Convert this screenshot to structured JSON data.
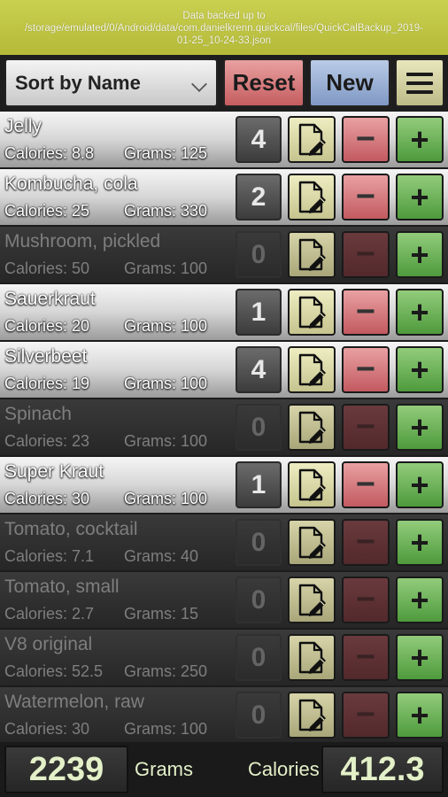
{
  "status_banner": {
    "line1": "Data backed up to",
    "line2": "/storage/emulated/0/Android/data/com.danielkrenn.quickcal/files/QuickCalBackup_2019-",
    "line3": "01-25_10-24-33.json"
  },
  "toolbar": {
    "sort_label": "Sort by Name",
    "reset_label": "Reset",
    "new_label": "New"
  },
  "labels": {
    "calories_prefix": "Calories: ",
    "grams_prefix": "Grams: "
  },
  "items": [
    {
      "name": "Jelly",
      "calories": "8.8",
      "grams": "125",
      "count": "4",
      "active": true
    },
    {
      "name": "Kombucha, cola",
      "calories": "25",
      "grams": "330",
      "count": "2",
      "active": true
    },
    {
      "name": "Mushroom, pickled",
      "calories": "50",
      "grams": "100",
      "count": "0",
      "active": false
    },
    {
      "name": "Sauerkraut",
      "calories": "20",
      "grams": "100",
      "count": "1",
      "active": true
    },
    {
      "name": "Silverbeet",
      "calories": "19",
      "grams": "100",
      "count": "4",
      "active": true
    },
    {
      "name": "Spinach",
      "calories": "23",
      "grams": "100",
      "count": "0",
      "active": false
    },
    {
      "name": "Super Kraut",
      "calories": "30",
      "grams": "100",
      "count": "1",
      "active": true
    },
    {
      "name": "Tomato, cocktail",
      "calories": "7.1",
      "grams": "40",
      "count": "0",
      "active": false
    },
    {
      "name": "Tomato, small",
      "calories": "2.7",
      "grams": "15",
      "count": "0",
      "active": false
    },
    {
      "name": "V8 original",
      "calories": "52.5",
      "grams": "250",
      "count": "0",
      "active": false
    },
    {
      "name": "Watermelon, raw",
      "calories": "30",
      "grams": "100",
      "count": "0",
      "active": false
    }
  ],
  "footer": {
    "grams_total": "2239",
    "grams_label": "Grams",
    "calories_label": "Calories",
    "calories_total": "412.3"
  },
  "icons": {
    "edit": "edit-document-icon",
    "minus": "minus-icon",
    "plus": "plus-icon",
    "menu": "hamburger-menu-icon"
  },
  "colors": {
    "banner": "#c1c745",
    "reset": "#d57b7e",
    "new": "#9ab0d6",
    "plus": "#6fb35a",
    "minus": "#d77a7e",
    "totals_text": "#e3f0c8"
  }
}
